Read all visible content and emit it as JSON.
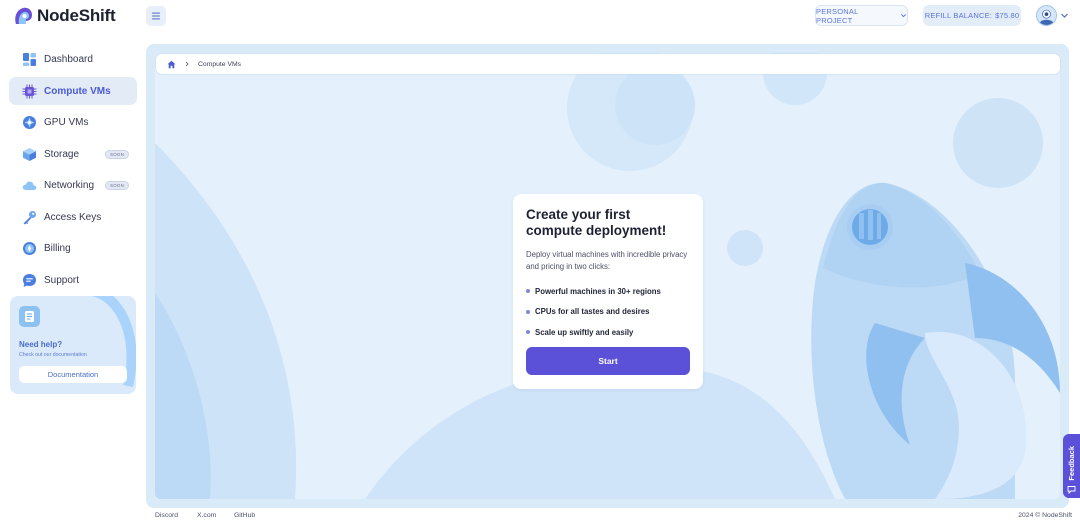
{
  "app": {
    "name": "NodeShift"
  },
  "header": {
    "project_label": "PERSONAL PROJECT",
    "balance_label": "REFILL BALANCE:",
    "balance_value": "$75.80"
  },
  "sidebar": {
    "items": [
      {
        "label": "Dashboard",
        "icon": "dashboard-icon",
        "active": false,
        "badge": ""
      },
      {
        "label": "Compute VMs",
        "icon": "chip-icon",
        "active": true,
        "badge": ""
      },
      {
        "label": "GPU VMs",
        "icon": "gpu-icon",
        "active": false,
        "badge": ""
      },
      {
        "label": "Storage",
        "icon": "storage-icon",
        "active": false,
        "badge": "SOON"
      },
      {
        "label": "Networking",
        "icon": "cloud-icon",
        "active": false,
        "badge": "SOON"
      },
      {
        "label": "Access Keys",
        "icon": "key-icon",
        "active": false,
        "badge": ""
      },
      {
        "label": "Billing",
        "icon": "billing-icon",
        "active": false,
        "badge": ""
      },
      {
        "label": "Support",
        "icon": "support-icon",
        "active": false,
        "badge": ""
      }
    ],
    "help": {
      "title": "Need help?",
      "subtitle": "Check out our documentation",
      "button": "Documentation"
    }
  },
  "breadcrumb": {
    "current": "Compute VMs"
  },
  "card": {
    "title": "Create your first compute deployment!",
    "description": "Deploy virtual machines with incredible privacy and pricing in two clicks:",
    "features": [
      "Powerful machines in 30+ regions",
      "CPUs for all tastes and desires",
      "Scale up swiftly and easily"
    ],
    "button": "Start"
  },
  "feedback": {
    "label": "Feedback"
  },
  "footer": {
    "links": [
      "Discord",
      "X.com",
      "GitHub"
    ],
    "copyright": "2024 © NodeShift"
  },
  "colors": {
    "accent": "#5b50d8",
    "brand_blue": "#4a5bd4",
    "active_bg": "#e2ebf6",
    "hero_bg": "#e4f0fc"
  }
}
